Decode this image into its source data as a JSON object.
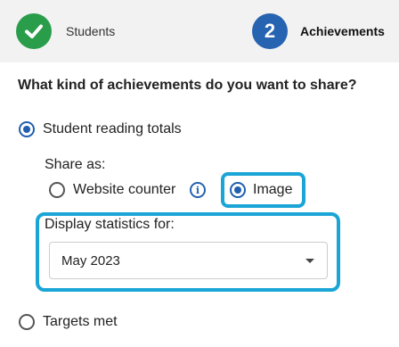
{
  "stepper": {
    "steps": [
      {
        "label": "Students",
        "status": "complete",
        "icon": "checkmark-icon"
      },
      {
        "label": "Achievements",
        "number": "2",
        "status": "current"
      }
    ]
  },
  "question": "What kind of achievements do you want to share?",
  "options": {
    "reading_totals": {
      "label": "Student reading totals",
      "selected": true
    },
    "targets_met": {
      "label": "Targets met",
      "selected": false
    }
  },
  "share_as": {
    "label": "Share as:",
    "options": [
      {
        "label": "Website counter",
        "selected": false
      },
      {
        "label": "Image",
        "selected": true
      }
    ],
    "info_icon": "info-icon"
  },
  "display_statistics": {
    "label": "Display statistics for:",
    "selected_value": "May 2023"
  },
  "colors": {
    "complete_green": "#2a9d4a",
    "current_blue": "#2663b0",
    "highlight_cyan": "#1aa5d6"
  }
}
